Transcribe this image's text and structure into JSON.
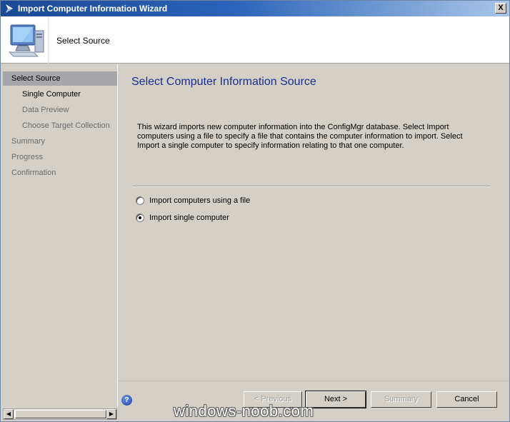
{
  "window": {
    "title": "Import Computer Information Wizard",
    "close_label": "X"
  },
  "header": {
    "step_title": "Select Source",
    "icon": "computer-icon"
  },
  "sidebar": {
    "items": [
      {
        "label": "Select Source",
        "level": "top",
        "state": "selected"
      },
      {
        "label": "Single Computer",
        "level": "sub",
        "state": "active"
      },
      {
        "label": "Data Preview",
        "level": "sub",
        "state": "inactive"
      },
      {
        "label": "Choose Target Collection",
        "level": "sub",
        "state": "inactive"
      },
      {
        "label": "Summary",
        "level": "top",
        "state": "inactive"
      },
      {
        "label": "Progress",
        "level": "top",
        "state": "inactive"
      },
      {
        "label": "Confirmation",
        "level": "top",
        "state": "inactive"
      }
    ],
    "scroll_left": "◀",
    "scroll_right": "▶"
  },
  "main": {
    "heading": "Select Computer Information Source",
    "description": "This wizard imports new computer information into the ConfigMgr database. Select Import computers using a file to specify a file that contains the computer information to import. Select Import a single computer to specify information relating to that one computer.",
    "options": [
      {
        "label": "Import computers using a file",
        "checked": false
      },
      {
        "label": "Import single computer",
        "checked": true
      }
    ]
  },
  "footer": {
    "help": "?",
    "previous": "< Previous",
    "next": "Next >",
    "summary": "Summary",
    "cancel": "Cancel"
  },
  "watermark": "windows-noob.com",
  "colors": {
    "title_gradient_start": "#1c4a95",
    "heading": "#1b2e8c",
    "selected_nav": "#a7a6aa",
    "dialog_bg": "#d4d0c8"
  }
}
